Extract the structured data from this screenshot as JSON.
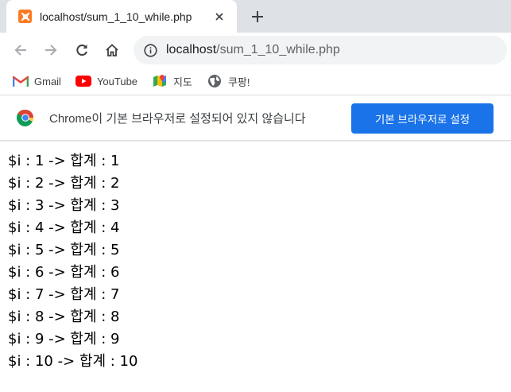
{
  "tab": {
    "title": "localhost/sum_1_10_while.php",
    "favicon": "xampp-icon",
    "favicon_color": "#fb7a24"
  },
  "toolbar": {
    "back_icon": "back-arrow-icon",
    "forward_icon": "forward-arrow-icon",
    "reload_icon": "reload-icon",
    "home_icon": "home-icon"
  },
  "omnibox": {
    "host": "localhost",
    "path": "/sum_1_10_while.php"
  },
  "bookmarks": [
    {
      "label": "Gmail",
      "icon": "gmail-icon"
    },
    {
      "label": "YouTube",
      "icon": "youtube-icon"
    },
    {
      "label": "지도",
      "icon": "maps-icon"
    },
    {
      "label": "쿠팡!",
      "icon": "globe-icon"
    }
  ],
  "infobar": {
    "message": "Chrome이 기본 브라우저로 설정되어 있지 않습니다",
    "button_label": "기본 브라우저로 설정",
    "button_color": "#1a73e8"
  },
  "output_lines": [
    "$i : 1 -> 합계 : 1",
    "$i : 2 -> 합계 : 2",
    "$i : 3 -> 합계 : 3",
    "$i : 4 -> 합계 : 4",
    "$i : 5 -> 합계 : 5",
    "$i : 6 -> 합계 : 6",
    "$i : 7 -> 합계 : 7",
    "$i : 8 -> 합계 : 8",
    "$i : 9 -> 합계 : 9",
    "$i : 10 -> 합계 : 10"
  ]
}
